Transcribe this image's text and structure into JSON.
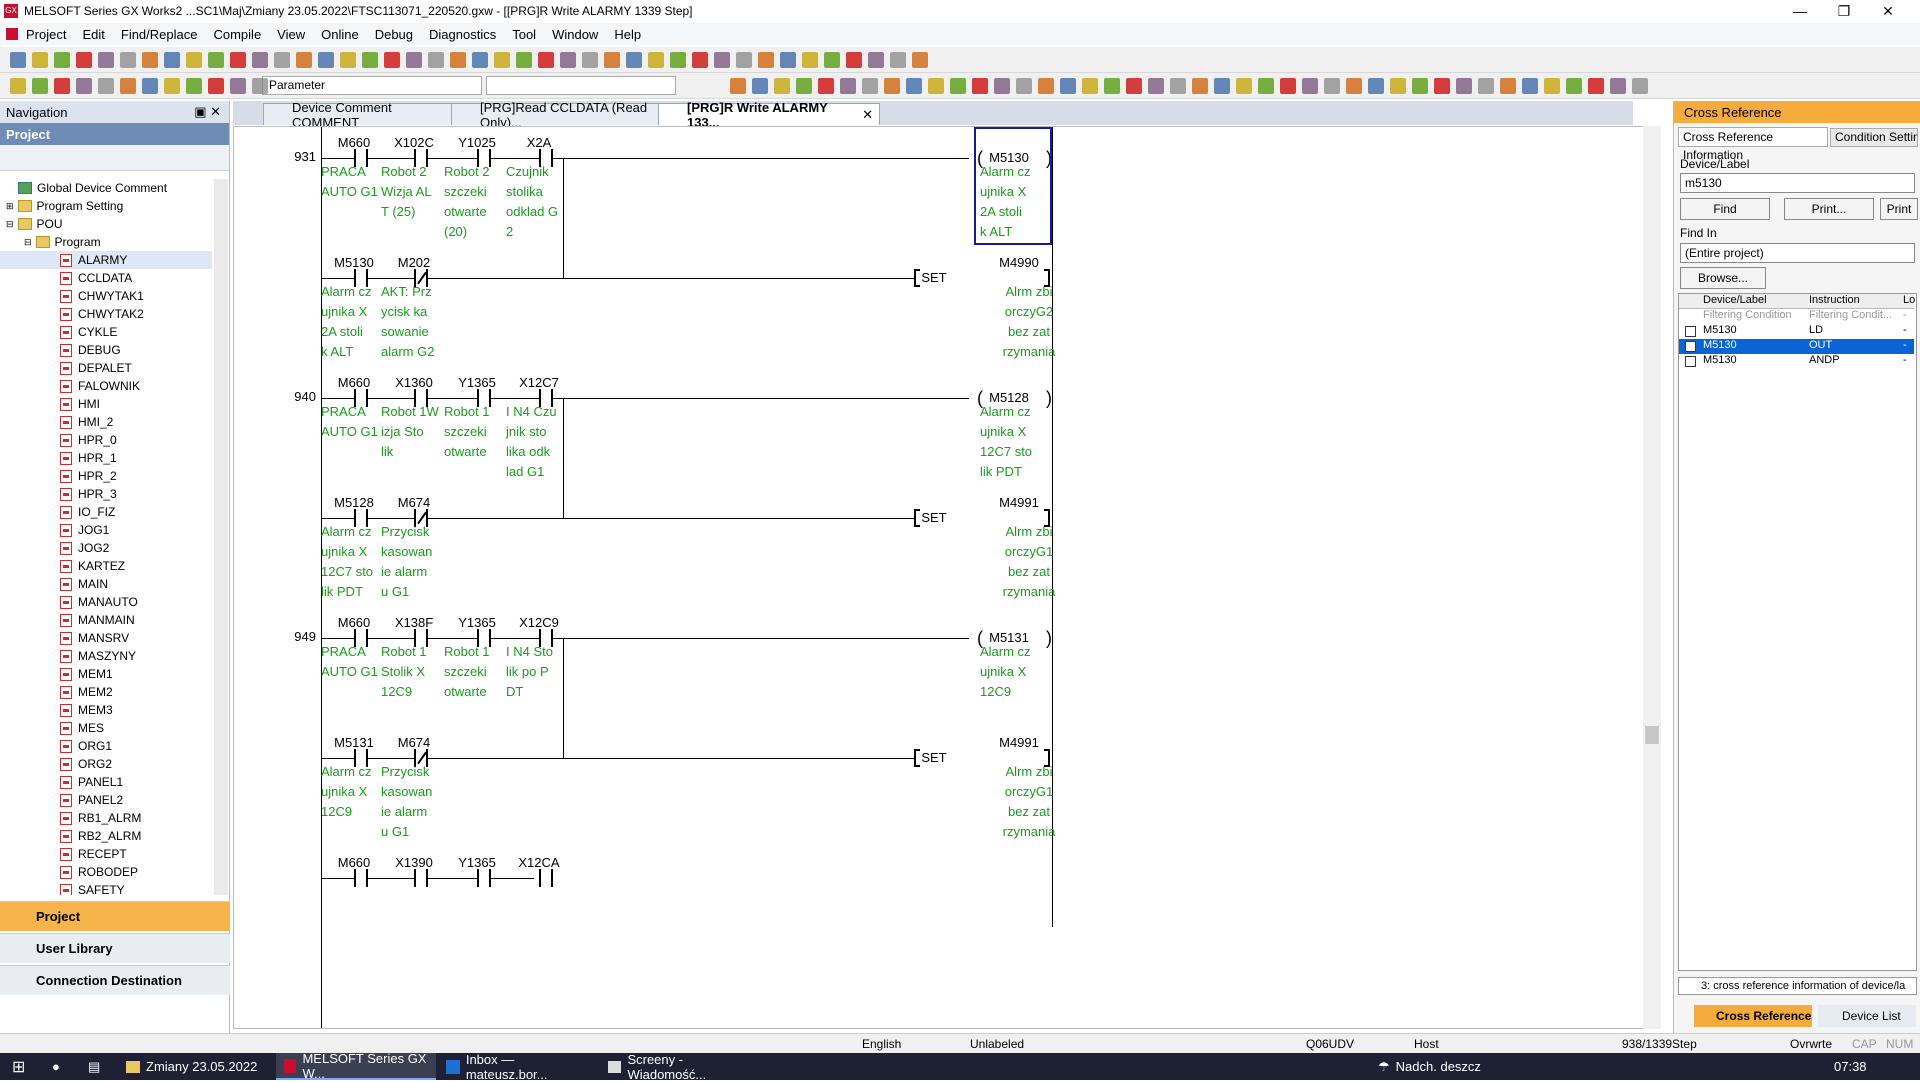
{
  "title": "MELSOFT Series GX Works2 ...SC1\\Maj\\Zmiany 23.05.2022\\FTSC113071_220520.gxw - [[PRG]R Write ALARMY 1339 Step]",
  "menu": [
    "Project",
    "Edit",
    "Find/Replace",
    "Compile",
    "View",
    "Online",
    "Debug",
    "Diagnostics",
    "Tool",
    "Window",
    "Help"
  ],
  "toolbar": {
    "parameter_label": "Parameter"
  },
  "navigation": {
    "header": "Navigation",
    "section": "Project",
    "tree_top": [
      "Global Device Comment",
      "Program Setting",
      "POU",
      "Program"
    ],
    "programs": [
      "ALARMY",
      "CCLDATA",
      "CHWYTAK1",
      "CHWYTAK2",
      "CYKLE",
      "DEBUG",
      "DEPALET",
      "FALOWNIK",
      "HMI",
      "HMI_2",
      "HPR_0",
      "HPR_1",
      "HPR_2",
      "HPR_3",
      "IO_FIZ",
      "JOG1",
      "JOG2",
      "KARTEZ",
      "MAIN",
      "MANAUTO",
      "MANMAIN",
      "MANSRV",
      "MASZYNY",
      "MEM1",
      "MEM2",
      "MEM3",
      "MES",
      "ORG1",
      "ORG2",
      "PANEL1",
      "PANEL2",
      "RB1_ALRM",
      "RB2_ALRM",
      "RECEPT",
      "ROBODEP",
      "SAFETY"
    ],
    "buttons": [
      "Project",
      "User Library",
      "Connection Destination"
    ]
  },
  "tabs": [
    "Device Comment COMMENT",
    "[PRG]Read CCLDATA (Read Only)...",
    "[PRG]R Write ALARMY 133..."
  ],
  "ladder": {
    "rungs": [
      {
        "step": "931",
        "contacts": [
          {
            "dev": "M660",
            "cmt": "PRACA\nAUTO G1",
            "nc": false
          },
          {
            "dev": "X102C",
            "cmt": "Robot 2\nWizja AL\nT (25)",
            "nc": false
          },
          {
            "dev": "Y1025",
            "cmt": "Robot 2\nszczeki\notwarte\n(20)",
            "nc": false
          },
          {
            "dev": "X2A",
            "cmt": "Czujnik\nstolika\nodklad G\n2",
            "nc": false
          }
        ],
        "coil": {
          "type": "OUT",
          "dev": "M5130",
          "cmt": "Alarm cz\nujnika X\n2A stoli\nk ALT"
        }
      },
      {
        "step": "",
        "contacts": [
          {
            "dev": "M5130",
            "cmt": "Alarm cz\nujnika X\n2A stoli\nk ALT",
            "nc": false
          },
          {
            "dev": "M202",
            "cmt": "AKT: Prz\nycisk ka\nsowanie\nalarm G2",
            "nc": true
          }
        ],
        "coil": {
          "type": "SET",
          "dev": "M4990",
          "cmt": "Alrm zbi\norczyG2\nbez zat\nrzymania"
        }
      },
      {
        "step": "940",
        "contacts": [
          {
            "dev": "M660",
            "cmt": "PRACA\nAUTO G1",
            "nc": false
          },
          {
            "dev": "X1360",
            "cmt": "Robot 1W\nizja Sto\nlik",
            "nc": false
          },
          {
            "dev": "Y1365",
            "cmt": "Robot 1\nszczeki\notwarte",
            "nc": false
          },
          {
            "dev": "X12C7",
            "cmt": "I N4 Czu\njnik sto\nlika odk\nlad G1",
            "nc": false
          }
        ],
        "coil": {
          "type": "OUT",
          "dev": "M5128",
          "cmt": "Alarm cz\nujnika X\n12C7 sto\nlik PDT"
        }
      },
      {
        "step": "",
        "contacts": [
          {
            "dev": "M5128",
            "cmt": "Alarm cz\nujnika X\n12C7 sto\nlik PDT",
            "nc": false
          },
          {
            "dev": "M674",
            "cmt": "Przycisk\n kasowan\nie alarm\nu G1",
            "nc": true
          }
        ],
        "coil": {
          "type": "SET",
          "dev": "M4991",
          "cmt": "Alrm zbi\norczyG1\nbez zat\nrzymania"
        }
      },
      {
        "step": "949",
        "contacts": [
          {
            "dev": "M660",
            "cmt": "PRACA\nAUTO G1",
            "nc": false
          },
          {
            "dev": "X138F",
            "cmt": "Robot 1\nStolik X\n12C9",
            "nc": false
          },
          {
            "dev": "Y1365",
            "cmt": "Robot 1\nszczeki\notwarte",
            "nc": false
          },
          {
            "dev": "X12C9",
            "cmt": "I N4 Sto\nlik po P\nDT",
            "nc": false
          }
        ],
        "coil": {
          "type": "OUT",
          "dev": "M5131",
          "cmt": "Alarm cz\nujnika X\n12C9"
        }
      },
      {
        "step": "",
        "contacts": [
          {
            "dev": "M5131",
            "cmt": "Alarm cz\nujnika X\n12C9",
            "nc": false
          },
          {
            "dev": "M674",
            "cmt": "Przycisk\n kasowan\nie alarm\nu G1",
            "nc": true
          }
        ],
        "coil": {
          "type": "SET",
          "dev": "M4991",
          "cmt": "Alrm zbi\norczyG1\nbez zat\nrzymania"
        }
      },
      {
        "step": "",
        "contacts": [
          {
            "dev": "M660",
            "cmt": "",
            "nc": false
          },
          {
            "dev": "X1390",
            "cmt": "",
            "nc": false
          },
          {
            "dev": "Y1365",
            "cmt": "",
            "nc": false
          },
          {
            "dev": "X12CA",
            "cmt": "",
            "nc": false
          }
        ],
        "coil": null
      }
    ]
  },
  "xref": {
    "title": "Cross Reference",
    "tabs": [
      "Cross Reference Information",
      "Condition Setting"
    ],
    "device_label": "Device/Label",
    "device_value": "m5130",
    "find": "Find",
    "print_dots": "Print...",
    "print": "Print",
    "find_in_label": "Find In",
    "find_in_value": "(Entire project)",
    "browse": "Browse...",
    "columns": [
      "Device/Label",
      "Instruction",
      "Lo"
    ],
    "filter_row": [
      "Filtering Condition",
      "Filtering Condit...",
      "-"
    ],
    "rows": [
      [
        "M5130",
        "LD",
        "-"
      ],
      [
        "M5130",
        "OUT",
        "-"
      ],
      [
        "M5130",
        "ANDP",
        "-"
      ]
    ],
    "footer": "3: cross reference information of device/la",
    "bottom_tabs": [
      "Cross Reference",
      "Device List"
    ]
  },
  "status": [
    "English",
    "Unlabeled",
    "Q06UDV",
    "Host",
    "938/1339Step",
    "Ovrwrte",
    "CAP",
    "NUM"
  ],
  "taskbar": {
    "items": [
      "Zmiany 23.05.2022",
      "MELSOFT Series GX W...",
      "Inbox — mateusz.bor...",
      "Screeny - Wiadomość..."
    ],
    "weather": "Nadch. deszcz",
    "time": "07:38"
  },
  "colors": {
    "comment": "#1b9b1b",
    "selection": "#0a64d6",
    "xref_header": "#f5ac3c",
    "nav_project": "#f6b44a"
  }
}
